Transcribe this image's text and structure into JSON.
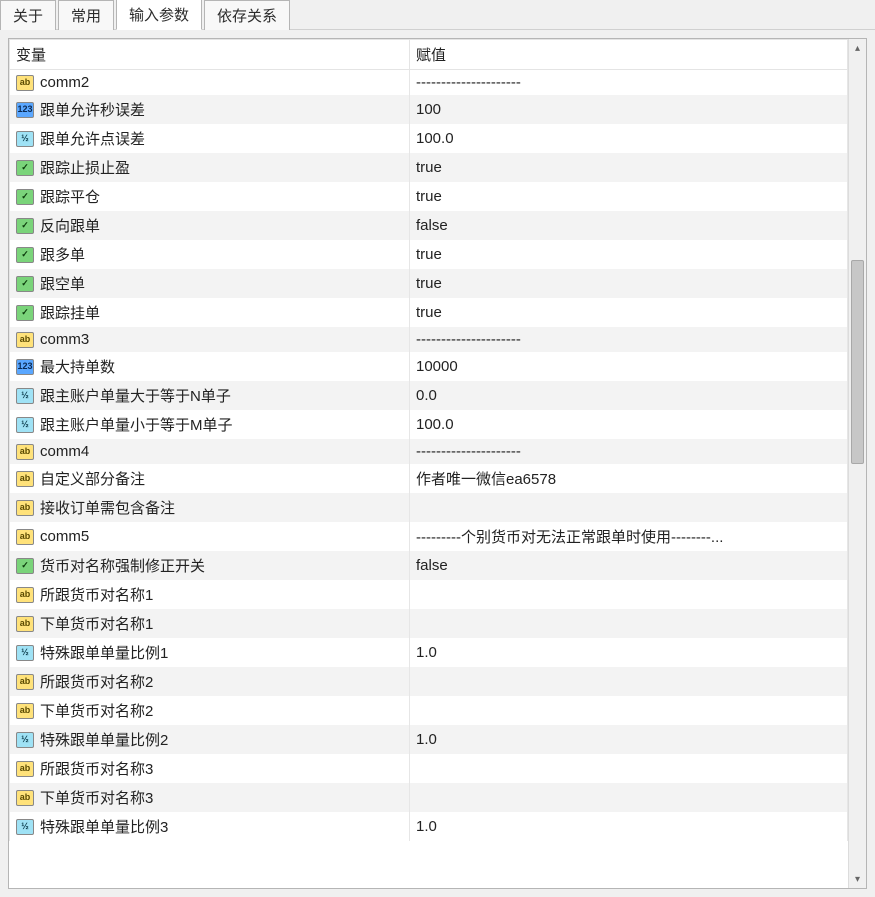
{
  "tabs": [
    {
      "label": "关于",
      "active": false
    },
    {
      "label": "常用",
      "active": false
    },
    {
      "label": "输入参数",
      "active": true
    },
    {
      "label": "依存关系",
      "active": false
    }
  ],
  "columns": {
    "variable": "变量",
    "value": "赋值"
  },
  "type_icons": {
    "string": "ab",
    "int": "123",
    "double": "½",
    "bool": "✓"
  },
  "rows": [
    {
      "type": "string",
      "name": "comm2",
      "value": "---------------------"
    },
    {
      "type": "int",
      "name": "跟单允许秒误差",
      "value": "100"
    },
    {
      "type": "double",
      "name": "跟单允许点误差",
      "value": "100.0"
    },
    {
      "type": "bool",
      "name": "跟踪止损止盈",
      "value": "true"
    },
    {
      "type": "bool",
      "name": "跟踪平仓",
      "value": "true"
    },
    {
      "type": "bool",
      "name": "反向跟单",
      "value": "false"
    },
    {
      "type": "bool",
      "name": "跟多单",
      "value": "true"
    },
    {
      "type": "bool",
      "name": "跟空单",
      "value": "true"
    },
    {
      "type": "bool",
      "name": "跟踪挂单",
      "value": "true"
    },
    {
      "type": "string",
      "name": "comm3",
      "value": "---------------------"
    },
    {
      "type": "int",
      "name": "最大持单数",
      "value": "10000"
    },
    {
      "type": "double",
      "name": "跟主账户单量大于等于N单子",
      "value": "0.0"
    },
    {
      "type": "double",
      "name": "跟主账户单量小于等于M单子",
      "value": "100.0"
    },
    {
      "type": "string",
      "name": "comm4",
      "value": "---------------------"
    },
    {
      "type": "string",
      "name": "自定义部分备注",
      "value": "作者唯一微信ea6578"
    },
    {
      "type": "string",
      "name": "接收订单需包含备注",
      "value": ""
    },
    {
      "type": "string",
      "name": "comm5",
      "value": "---------个别货币对无法正常跟单时使用--------..."
    },
    {
      "type": "bool",
      "name": "货币对名称强制修正开关",
      "value": "false"
    },
    {
      "type": "string",
      "name": "所跟货币对名称1",
      "value": ""
    },
    {
      "type": "string",
      "name": "下单货币对名称1",
      "value": ""
    },
    {
      "type": "double",
      "name": "特殊跟单单量比例1",
      "value": "1.0"
    },
    {
      "type": "string",
      "name": "所跟货币对名称2",
      "value": ""
    },
    {
      "type": "string",
      "name": "下单货币对名称2",
      "value": ""
    },
    {
      "type": "double",
      "name": "特殊跟单单量比例2",
      "value": "1.0"
    },
    {
      "type": "string",
      "name": "所跟货币对名称3",
      "value": ""
    },
    {
      "type": "string",
      "name": "下单货币对名称3",
      "value": ""
    },
    {
      "type": "double",
      "name": "特殊跟单单量比例3",
      "value": "1.0"
    }
  ]
}
